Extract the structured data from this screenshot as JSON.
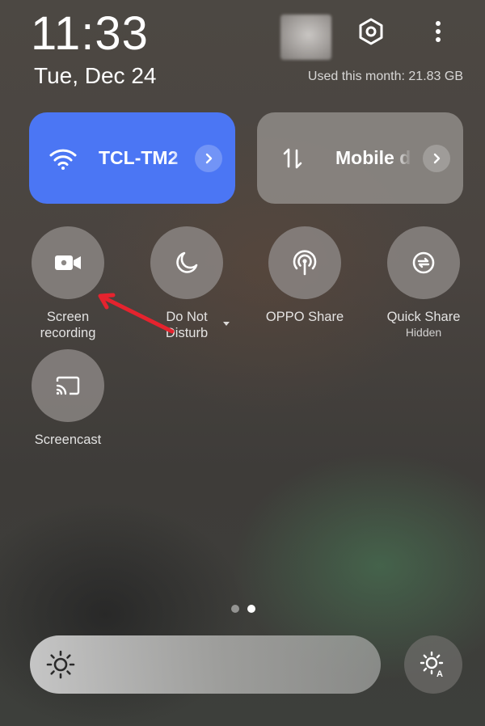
{
  "status": {
    "time": "11:33",
    "date": "Tue, Dec 24",
    "data_usage": "Used this month: 21.83 GB"
  },
  "header_icons": {
    "avatar": "avatar-blurred",
    "settings": "hexagon-gear-icon",
    "more": "vertical-dots-icon"
  },
  "large_tiles": [
    {
      "label": "TCL-TM2",
      "icon": "wifi-icon",
      "active": true,
      "color": "#4b76f4"
    },
    {
      "label": "Mobile d",
      "icon": "up-down-arrows-icon",
      "active": false
    }
  ],
  "quick_settings": [
    {
      "label_line1": "Screen",
      "label_line2": "recording",
      "sub": "",
      "icon": "video-camera-icon"
    },
    {
      "label_line1": "Do Not",
      "label_line2": "Disturb",
      "sub": "",
      "icon": "crescent-moon-icon"
    },
    {
      "label_line1": "OPPO Share",
      "label_line2": "",
      "sub": "",
      "icon": "broadcast-icon"
    },
    {
      "label_line1": "Quick Share",
      "label_line2": "",
      "sub": "Hidden",
      "icon": "share-sync-icon"
    },
    {
      "label_line1": "Screencast",
      "label_line2": "",
      "sub": "",
      "icon": "cast-icon"
    }
  ],
  "pager": {
    "count": 2,
    "active_index": 1
  },
  "brightness": {
    "level": 1.0,
    "auto_icon": "auto-brightness-icon"
  },
  "annotation": {
    "color": "#e5232e"
  }
}
